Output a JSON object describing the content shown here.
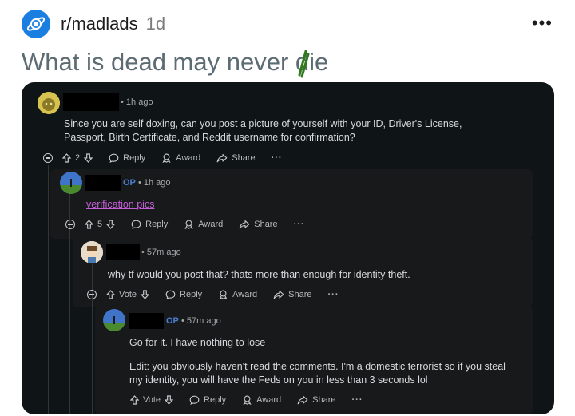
{
  "header": {
    "subreddit": "r/madlads",
    "age": "1d",
    "more": "•••"
  },
  "post": {
    "title": "What is dead may never die"
  },
  "labels": {
    "reply": "Reply",
    "award": "Award",
    "share": "Share",
    "more": "···",
    "vote": "Vote",
    "op": "OP"
  },
  "comments": [
    {
      "time": "1h ago",
      "text": "Since you are self doxing, can you post a picture of yourself with your ID, Driver's License, Passport, Birth Certificate, and Reddit username for confirmation?",
      "votes": "2"
    },
    {
      "time": "1h ago",
      "text": "verification pics",
      "votes": "5"
    },
    {
      "time": "57m ago",
      "text": "why tf would you post that? thats more than enough for identity theft.",
      "votes": "Vote"
    },
    {
      "time": "57m ago",
      "text_1": "Go for it. I have nothing to lose",
      "text_2": "Edit: you obviously haven't read the comments. I'm a domestic terrorist so if you steal my identity, you will have the Feds on you in less than 3 seconds lol",
      "votes": "Vote"
    }
  ]
}
